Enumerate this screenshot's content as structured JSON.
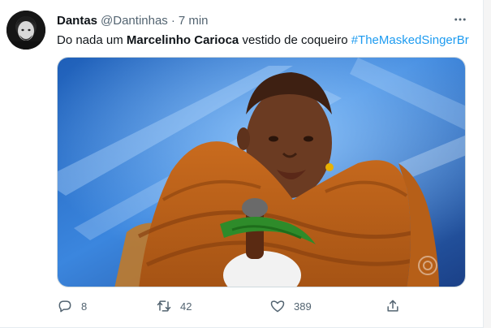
{
  "tweet": {
    "author_name": "Dantas",
    "author_handle": "@Dantinhas",
    "separator": "·",
    "time": "7 min",
    "text_prefix": "Do nada um ",
    "text_bold": "Marcelinho Carioca",
    "text_middle": " vestido de coqueiro ",
    "hashtag": "#TheMaskedSingerBr"
  },
  "media": {
    "watermark_icon": "globoplay-logo"
  },
  "actions": {
    "reply": {
      "icon": "reply-icon",
      "count": "8"
    },
    "retweet": {
      "icon": "retweet-icon",
      "count": "42"
    },
    "like": {
      "icon": "heart-icon",
      "count": "389"
    },
    "share": {
      "icon": "share-icon"
    }
  },
  "colors": {
    "hashtag": "#1d9bf0",
    "secondary_text": "#536471",
    "primary_text": "#0f1419"
  }
}
